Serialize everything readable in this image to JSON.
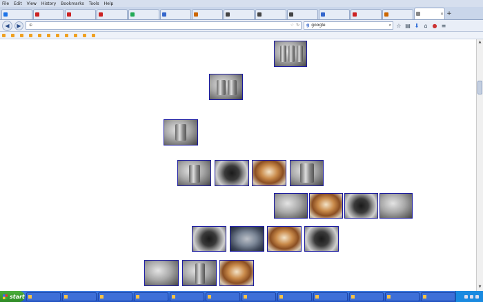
{
  "menubar": [
    "File",
    "Edit",
    "View",
    "History",
    "Bookmarks",
    "Tools",
    "Help"
  ],
  "tabs": [
    {
      "label": "",
      "color": "#1a73e8"
    },
    {
      "label": "",
      "color": "#cc2222"
    },
    {
      "label": "",
      "color": "#cc2222"
    },
    {
      "label": "",
      "color": "#cc2222"
    },
    {
      "label": "",
      "color": "#22aa55"
    },
    {
      "label": "",
      "color": "#3366cc"
    },
    {
      "label": "",
      "color": "#cc6600"
    },
    {
      "label": "",
      "color": "#444444"
    },
    {
      "label": "",
      "color": "#444444"
    },
    {
      "label": "",
      "color": "#444444"
    },
    {
      "label": "",
      "color": "#3366cc"
    },
    {
      "label": "",
      "color": "#cc2222"
    },
    {
      "label": "",
      "color": "#cc6600"
    },
    {
      "label": "",
      "color": "#888888",
      "active": true
    }
  ],
  "nav": {
    "url": "",
    "search": "google"
  },
  "bookmarks": [
    "",
    "",
    "",
    "",
    "",
    "",
    "",
    "",
    "",
    "",
    ""
  ],
  "content": {
    "para1": "",
    "para2": "",
    "para3": "",
    "para4": "",
    "para5": "",
    "para6": "",
    "para7": "",
    "para8": "",
    "para9": ""
  },
  "taskbar": {
    "start": "start",
    "items": [
      "",
      "",
      "",
      "",
      "",
      "",
      "",
      "",
      "",
      "",
      "",
      ""
    ],
    "time": ""
  }
}
